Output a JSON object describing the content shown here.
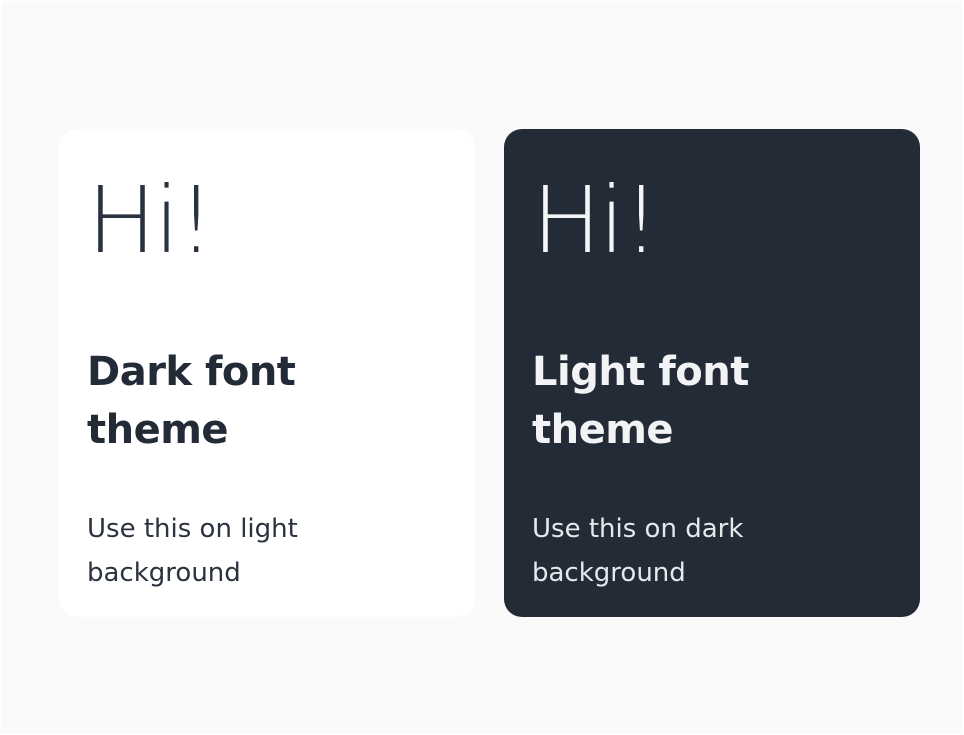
{
  "cards": [
    {
      "greeting": "Hi!",
      "title": "Dark font theme",
      "description": "Use this on light background",
      "background": "#ffffff",
      "text_color": "#232b37"
    },
    {
      "greeting": "Hi!",
      "title": "Light font theme",
      "description": "Use this on dark background",
      "background": "#232b37",
      "text_color": "#f2f3f5"
    }
  ]
}
